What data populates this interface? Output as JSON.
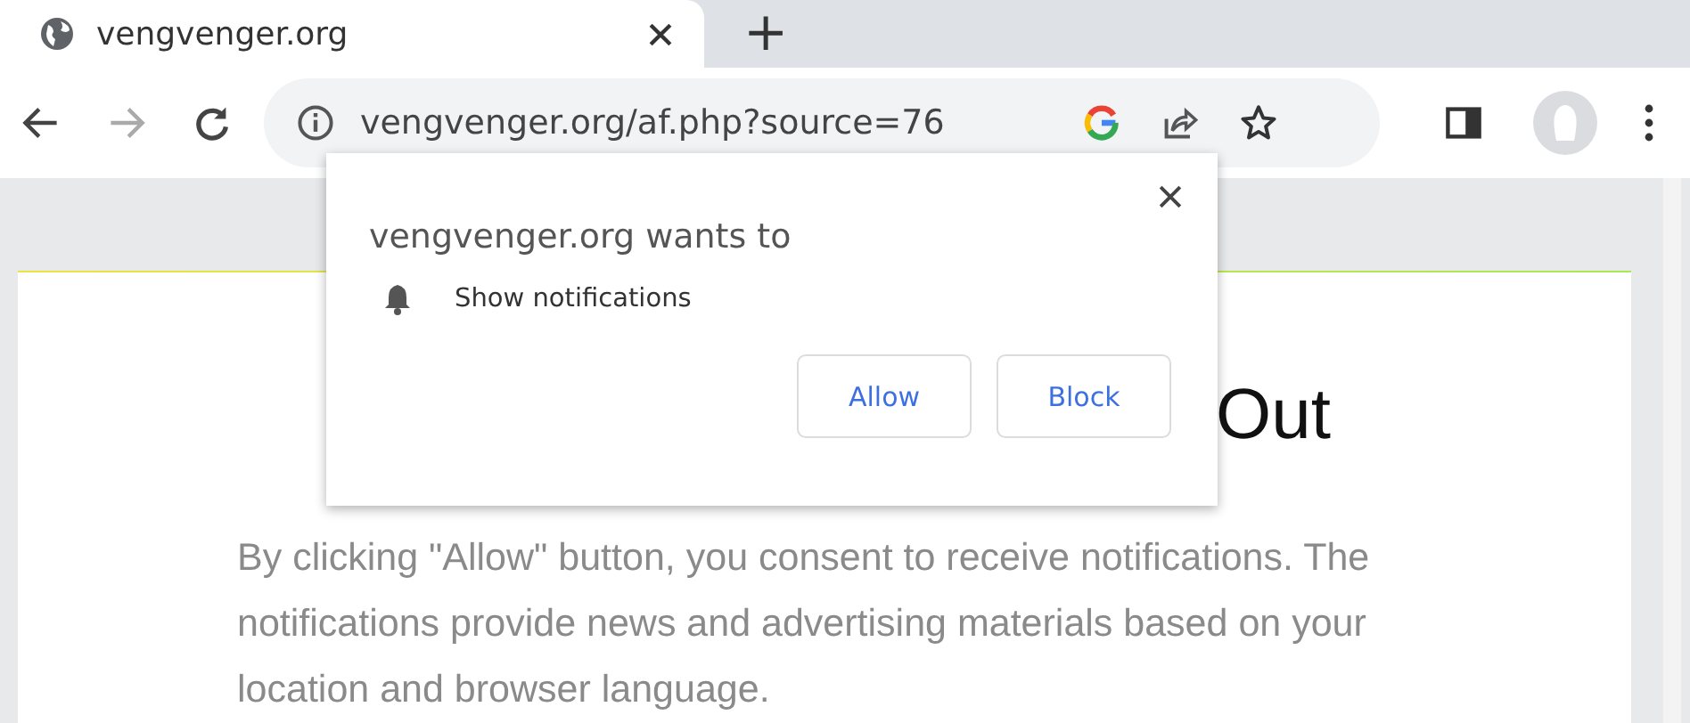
{
  "tab": {
    "title": "vengvenger.org",
    "new_tab": "+"
  },
  "omnibox": {
    "url": "vengvenger.org/af.php?source=76"
  },
  "permission_prompt": {
    "title": "vengvenger.org wants to",
    "permission": "Show notifications",
    "buttons": [
      "Allow",
      "Block"
    ]
  },
  "page": {
    "heading": "Out",
    "body": "By clicking \"Allow\" button, you consent to receive notifications. The notifications provide news and advertising materials based on your location and browser language."
  }
}
